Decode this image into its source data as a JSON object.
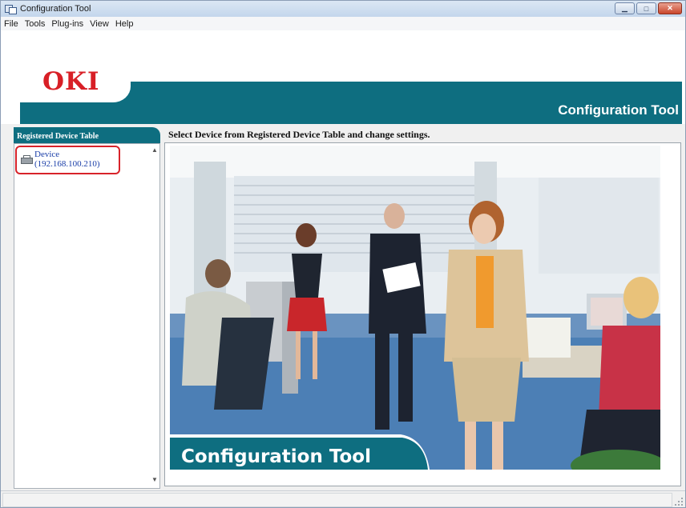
{
  "window": {
    "title": "Configuration Tool",
    "icon": "app-icon",
    "controls": [
      "minimize",
      "maximize",
      "close"
    ]
  },
  "menu": [
    {
      "label": "File"
    },
    {
      "label": "Tools"
    },
    {
      "label": "Plug-ins"
    },
    {
      "label": "View"
    },
    {
      "label": "Help"
    }
  ],
  "header": {
    "logo_text": "OKI",
    "title": "Configuration Tool",
    "accent_color": "#0e6e80",
    "logo_color": "#d81f26"
  },
  "left_panel": {
    "tab_label": "Registered Device Table",
    "devices": [
      {
        "name": "Device",
        "address": "(192.168.100.210)",
        "icon": "printer-icon",
        "highlighted": true
      }
    ]
  },
  "main": {
    "instruction": "Select Device from Registered Device Table and change settings.",
    "banner_text": "Configuration Tool"
  },
  "status_bar": {
    "text": ""
  }
}
